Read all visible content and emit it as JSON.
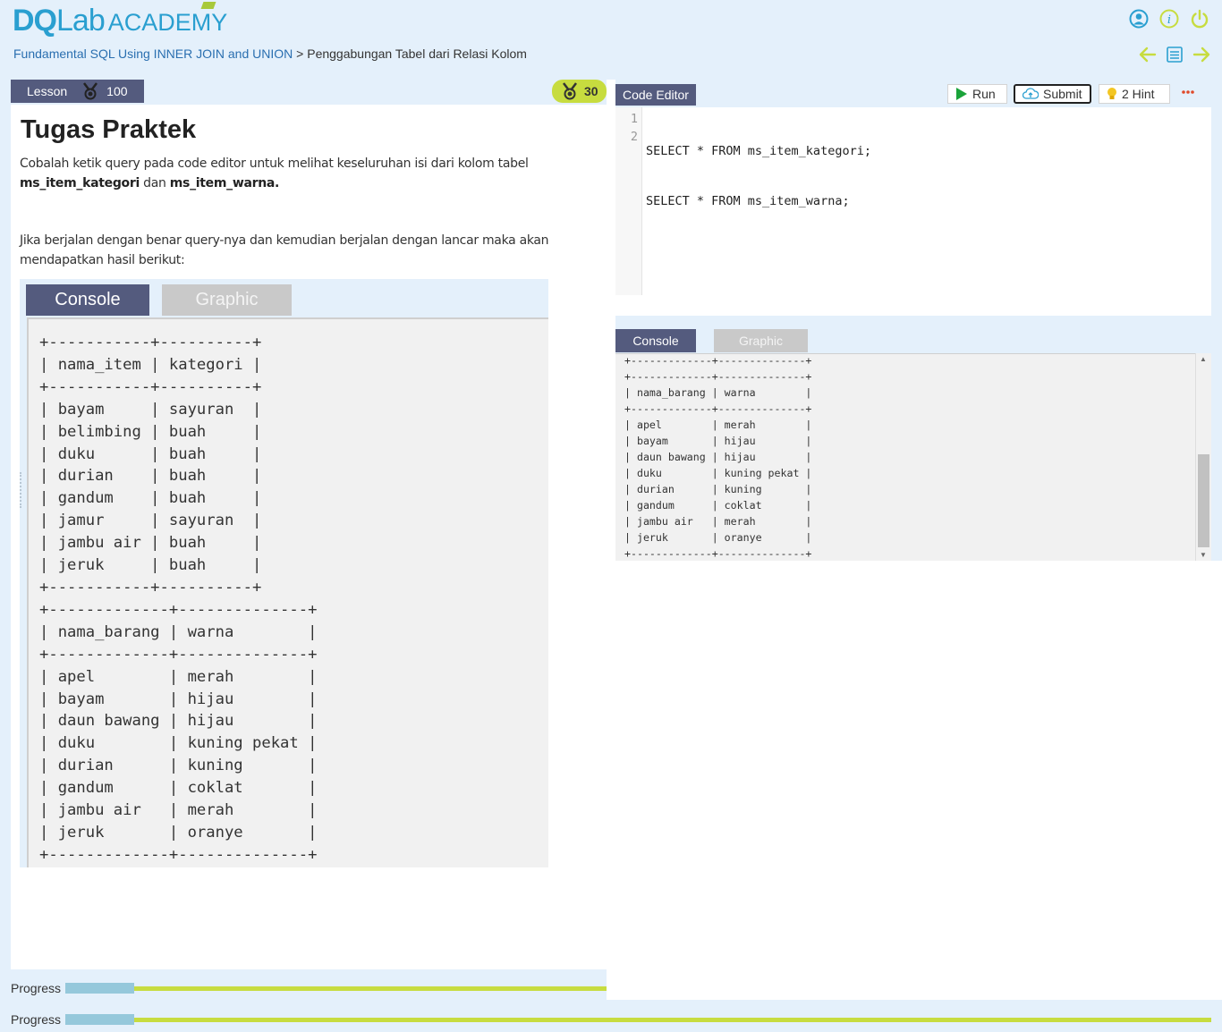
{
  "brand": {
    "logo_part1": "DQ",
    "logo_part2": "Lab",
    "logo_part3": "ACADEMY"
  },
  "breadcrumb": {
    "course": "Fundamental SQL Using INNER JOIN and UNION",
    "separator": ">",
    "current": "Penggabungan Tabel dari Relasi Kolom"
  },
  "lesson": {
    "tab_label": "Lesson",
    "score": "100",
    "points": "30",
    "title": "Tugas Praktek",
    "para1_prefix": "Cobalah ketik query pada code editor untuk melihat keseluruhan isi dari kolom tabel",
    "para1_table1": "ms_item_kategori",
    "para1_mid": "dan",
    "para1_table2": "ms_item_warna.",
    "para2": "Jika berjalan dengan benar query-nya dan kemudian berjalan dengan lancar maka akan mendapatkan hasil berikut:",
    "example_tabs": [
      "Console",
      "Graphic"
    ],
    "example_output": "+-----------+----------+\n| nama_item | kategori |\n+-----------+----------+\n| bayam     | sayuran  |\n| belimbing | buah     |\n| duku      | buah     |\n| durian    | buah     |\n| gandum    | buah     |\n| jamur     | sayuran  |\n| jambu air | buah     |\n| jeruk     | buah     |\n+-----------+----------+\n+-------------+--------------+\n| nama_barang | warna        |\n+-------------+--------------+\n| apel        | merah        |\n| bayam       | hijau        |\n| daun bawang | hijau        |\n| duku        | kuning pekat |\n| durian      | kuning       |\n| gandum      | coklat       |\n| jambu air   | merah        |\n| jeruk       | oranye       |\n+-------------+--------------+"
  },
  "editor": {
    "tab_label": "Code Editor",
    "run_label": "Run",
    "submit_label": "Submit",
    "hint_label": "2 Hint",
    "line_numbers": [
      "1",
      "2"
    ],
    "code_lines": [
      "SELECT * FROM ms_item_kategori;",
      "SELECT * FROM ms_item_warna;"
    ]
  },
  "output": {
    "tabs": [
      "Console",
      "Graphic"
    ],
    "text": "+-------------+--------------+\n+-------------+--------------+\n| nama_barang | warna        |\n+-------------+--------------+\n| apel        | merah        |\n| bayam       | hijau        |\n| daun bawang | hijau        |\n| duku        | kuning pekat |\n| durian      | kuning       |\n| gandum      | coklat       |\n| jambu air   | merah        |\n| jeruk       | oranye       |\n+-------------+--------------+"
  },
  "progress": {
    "label": "Progress",
    "value_fraction": 0.06
  },
  "colors": {
    "accent_dark": "#545b7e",
    "accent_green": "#c7dc3f",
    "brand_blue": "#2a9fd0",
    "progress_blue": "#95c8db"
  }
}
